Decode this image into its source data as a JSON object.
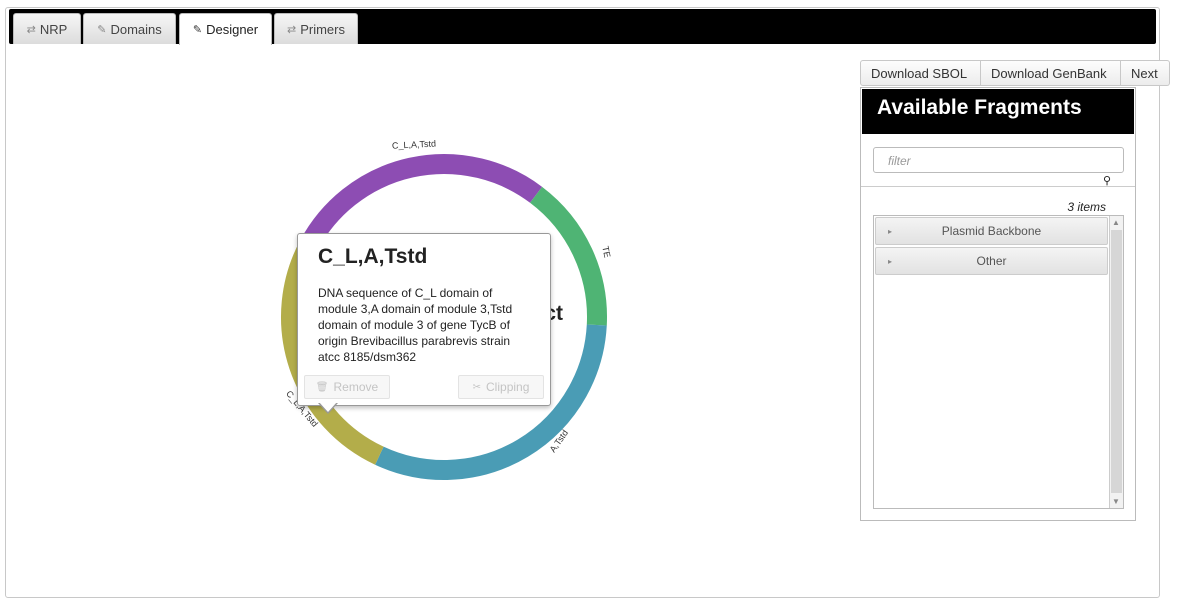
{
  "tabs": [
    {
      "label": "NRP",
      "icon": "swap-icon"
    },
    {
      "label": "Domains",
      "icon": "pencil-icon"
    },
    {
      "label": "Designer",
      "icon": "pencil-icon",
      "active": true
    },
    {
      "label": "Primers",
      "icon": "swap-icon"
    }
  ],
  "toolbar": {
    "download_sbol": "Download SBOL",
    "download_genbank": "Download GenBank",
    "next": "Next"
  },
  "fragments_panel": {
    "title": "Available Fragments",
    "filter_placeholder": "filter",
    "item_count": "3 items",
    "groups": [
      "Plasmid Backbone",
      "Other"
    ]
  },
  "plasmid": {
    "center_title_partial": "ct",
    "segments": [
      {
        "label": "C_L,A,Tstd",
        "color": "#8d4db3"
      },
      {
        "label": "TE",
        "color": "#4fb474"
      },
      {
        "label": "A,Tstd",
        "color": "#4a9cb5"
      },
      {
        "label": "C_L,A,Tstd",
        "color": "#b3ad4a"
      }
    ]
  },
  "popover": {
    "title": "C_L,A,Tstd",
    "description": "DNA sequence of C_L domain of module 3,A domain of module 3,Tstd domain of module 3 of gene TycB of origin Brevibacillus parabrevis strain atcc 8185/dsm362",
    "remove_label": "Remove",
    "clipping_label": "Clipping"
  }
}
